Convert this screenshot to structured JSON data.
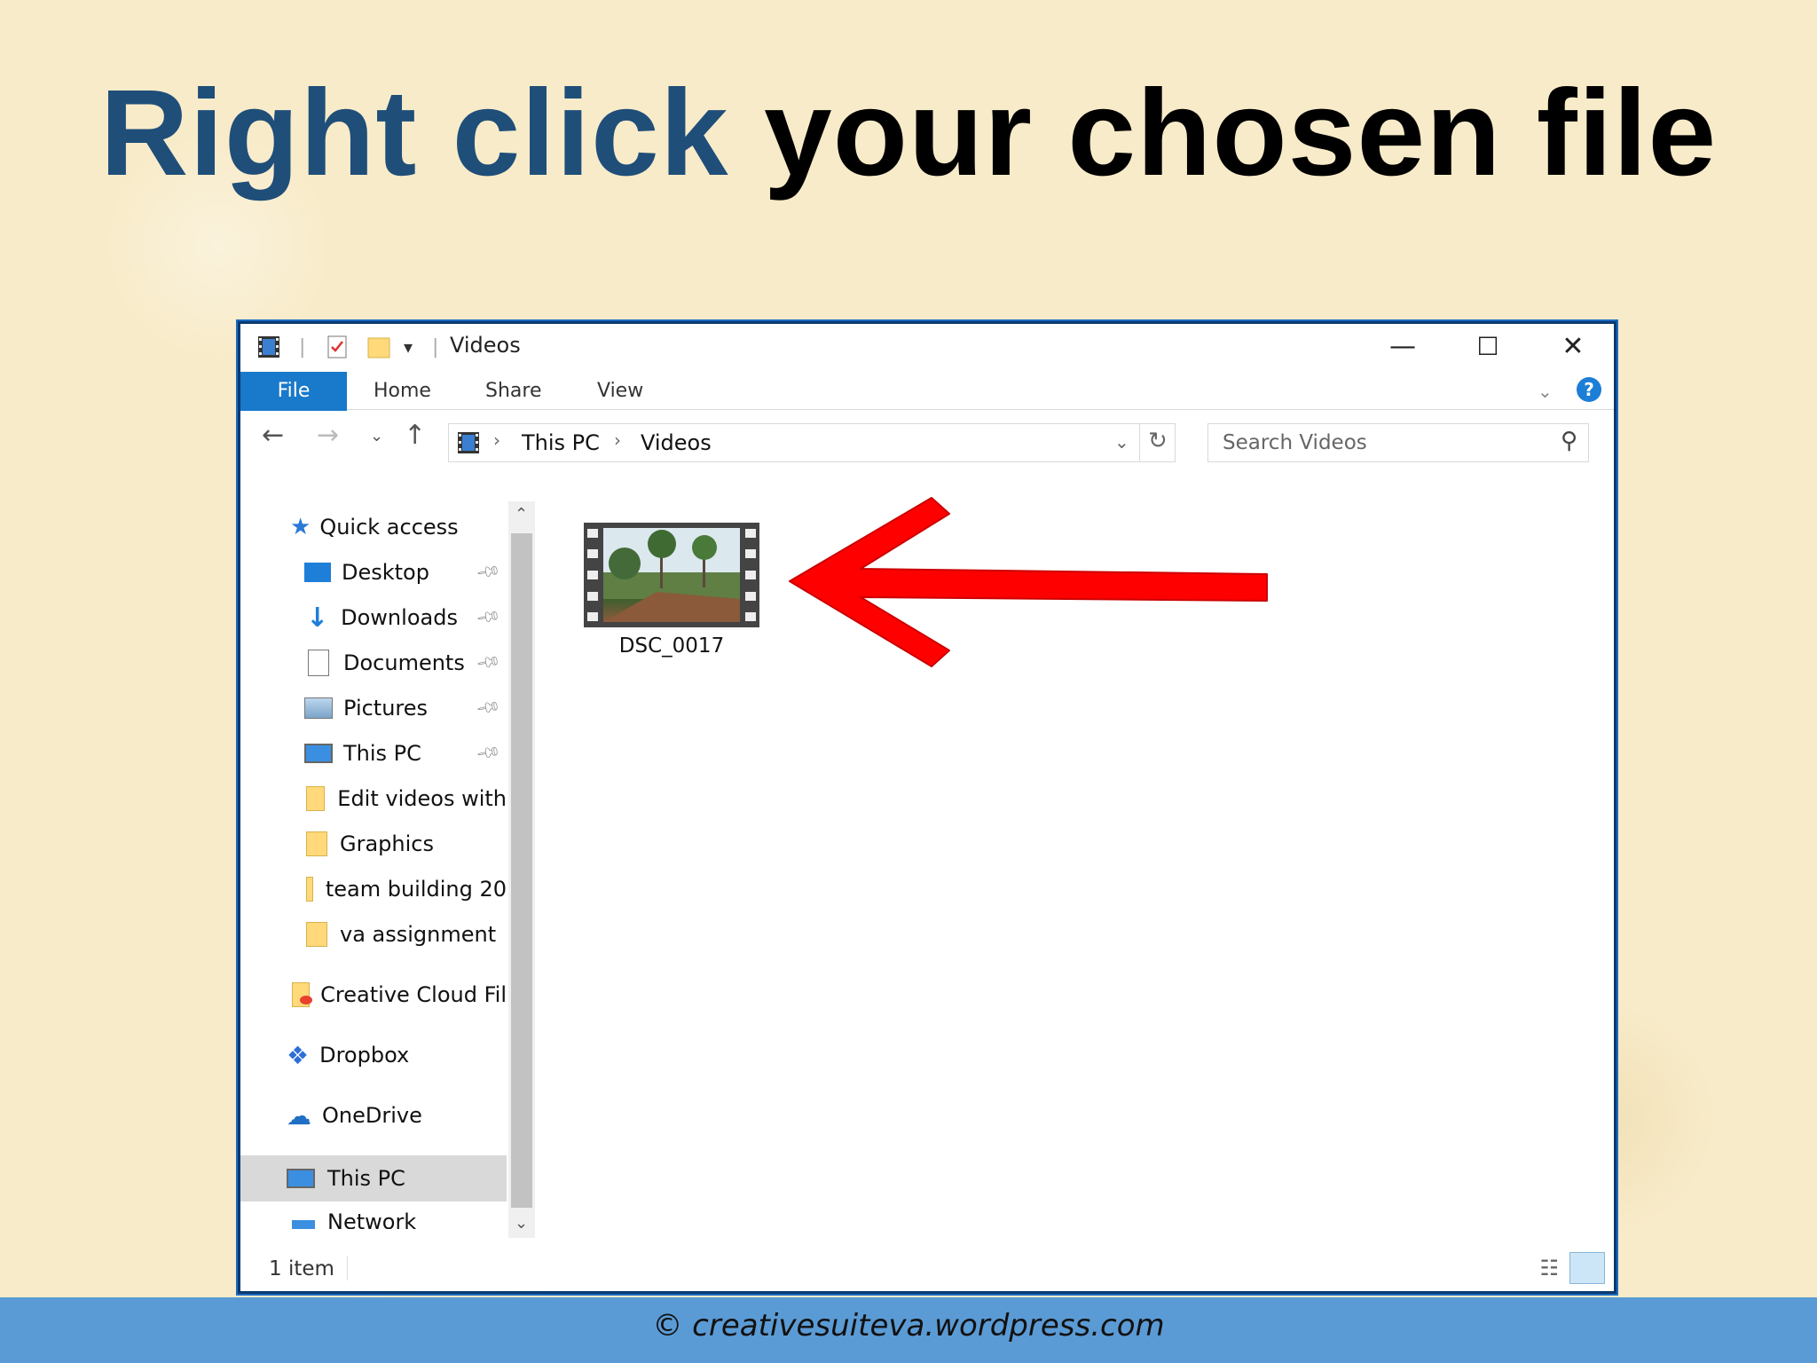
{
  "slide": {
    "title_accent": "Right click",
    "title_rest": "your chosen file",
    "footer": "© creativesuiteva.wordpress.com"
  },
  "window": {
    "title": "Videos",
    "controls": {
      "minimize": "—",
      "maximize": "☐",
      "close": "✕"
    }
  },
  "ribbon": {
    "tabs": [
      "File",
      "Home",
      "Share",
      "View"
    ],
    "help": "?"
  },
  "address": {
    "crumbs": [
      "This PC",
      "Videos"
    ],
    "search_placeholder": "Search Videos"
  },
  "nav_pane": {
    "quick_access": "Quick access",
    "items": [
      "Desktop",
      "Downloads",
      "Documents",
      "Pictures",
      "This PC",
      "Edit videos with",
      "Graphics",
      "team building 20",
      "va assignment"
    ],
    "creative_cloud": "Creative Cloud Fil",
    "dropbox": "Dropbox",
    "onedrive": "OneDrive",
    "this_pc": "This PC",
    "network": "Network"
  },
  "content": {
    "file_name": "DSC_0017"
  },
  "status_bar": {
    "count": "1 item"
  },
  "colors": {
    "accent_title": "#1f4e79",
    "file_tab": "#1979ca",
    "footer_bar": "#5b9bd5",
    "arrow": "#ff0000"
  }
}
